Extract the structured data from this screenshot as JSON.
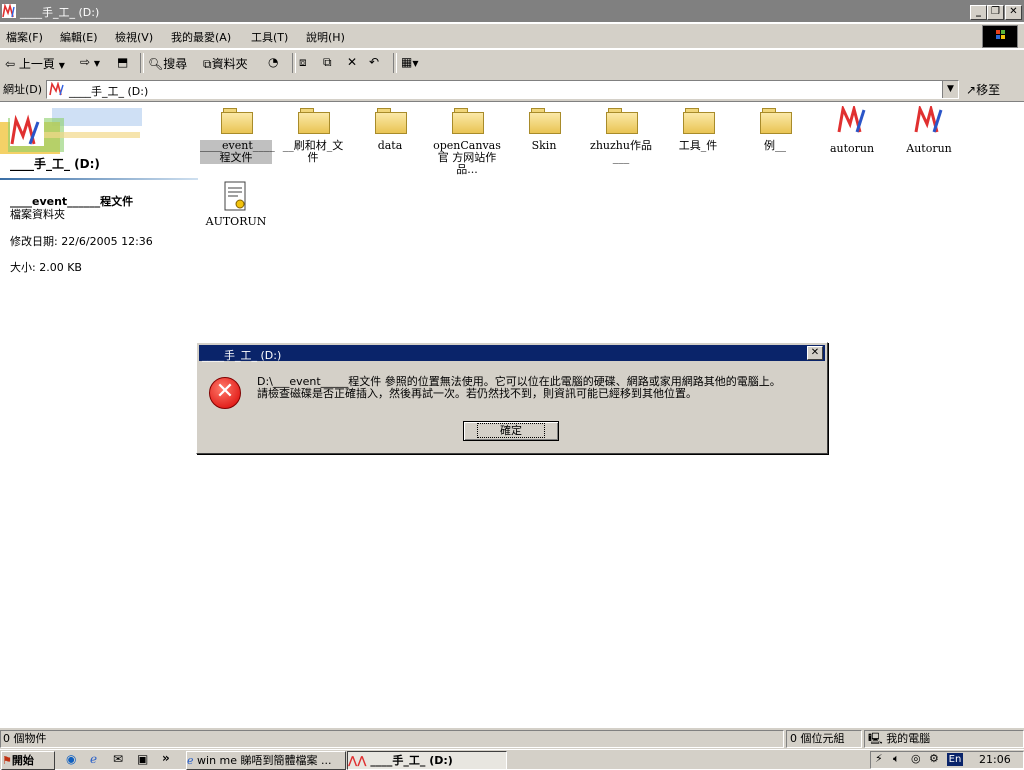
{
  "window": {
    "title": "____手_工_ (D:)",
    "controls": [
      "_",
      "▯",
      "×"
    ]
  },
  "menu": [
    "檔案(F)",
    "編輯(E)",
    "檢視(V)",
    "我的最愛(A)",
    "工具(T)",
    "說明(H)"
  ],
  "toolbar": {
    "back": "上一頁",
    "search": "搜尋",
    "folders": "資料夾"
  },
  "address": {
    "label": "網址(D)",
    "value": "____手_工_ (D:)",
    "go": "移至"
  },
  "left_pane": {
    "folder_title": "____手_工_ (D:)",
    "selected_name": "____event______程文件",
    "selected_type": "檔案資料夾",
    "modified": "修改日期: 22/6/2005 12:36",
    "size": "大小: 2.00 KB"
  },
  "items": [
    {
      "label": "____event____ 程文件",
      "kind": "folder"
    },
    {
      "label": "__刷和材_文 件",
      "kind": "folder"
    },
    {
      "label": "data",
      "kind": "folder"
    },
    {
      "label": "openCanvas官 方网站作品...",
      "kind": "folder"
    },
    {
      "label": "Skin",
      "kind": "folder"
    },
    {
      "label": "zhuzhu作品 ___",
      "kind": "folder"
    },
    {
      "label": "工具_件",
      "kind": "folder"
    },
    {
      "label": "例__",
      "kind": "folder"
    },
    {
      "label": "autorun",
      "kind": "logo"
    },
    {
      "label": "Autorun",
      "kind": "logo"
    },
    {
      "label": "AUTORUN",
      "kind": "inf"
    }
  ],
  "dialog": {
    "title": "____手_工_ (D:)",
    "message_line1": "D:\\___event_____程文件 參照的位置無法使用。它可以位在此電腦的硬碟、網路或家用網路其他的電腦上。",
    "message_line2": "請檢查磁碟是否正確插入，然後再試一次。若仍然找不到，則資訊可能已經移到其他位置。",
    "ok": "確定"
  },
  "status": {
    "objects": "0 個物件",
    "bytes": "0 個位元組",
    "zone": "我的電腦"
  },
  "taskbar": {
    "start": "開始",
    "chevron": "»",
    "tasks": [
      "win me 睇唔到簡體檔案 ...",
      "____手_工_ (D:)"
    ],
    "lang": "En",
    "clock": "21:06"
  },
  "colors": {
    "dialog_title_bg": "#0a246a",
    "error_red": "#d80000",
    "face": "#d4d0c8"
  }
}
